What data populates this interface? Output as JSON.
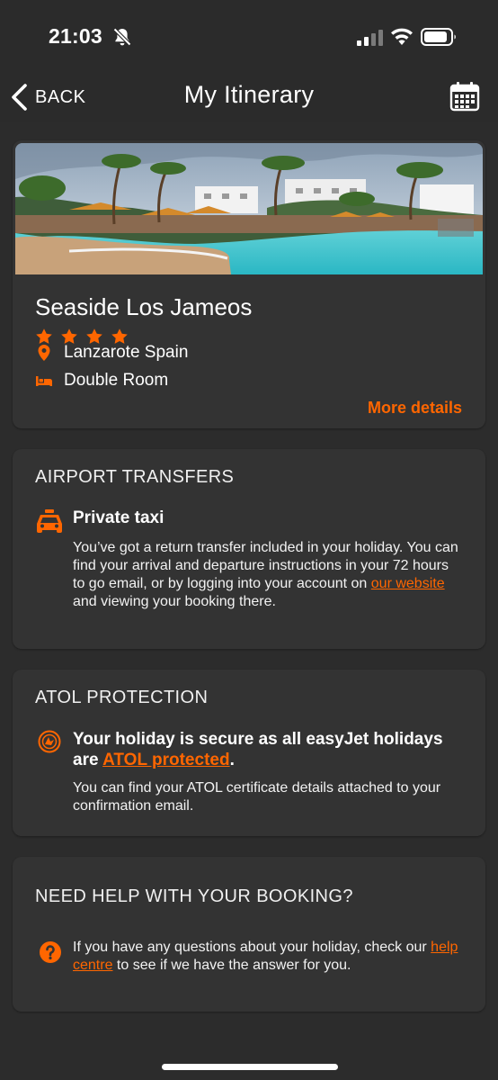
{
  "status_bar": {
    "time": "21:03"
  },
  "nav": {
    "back_label": "BACK",
    "title": "My Itinerary"
  },
  "hotel": {
    "name": "Seaside Los Jameos",
    "star_rating": 4,
    "location": "Lanzarote Spain",
    "room": "Double Room",
    "more_details": "More details"
  },
  "transfers": {
    "section_title": "AIRPORT TRANSFERS",
    "heading": "Private taxi",
    "body_before_link": "You’ve got a return transfer included in your holiday. You can find your arrival and departure instructions in your 72 hours to go email, or by logging into your account on ",
    "link": "our website",
    "body_after_link": " and viewing your booking there."
  },
  "atol": {
    "section_title": "ATOL PROTECTION",
    "heading_before_link": "Your holiday is secure as all easyJet holidays are ",
    "link": "ATOL protected",
    "heading_after_link": ".",
    "body": "You can find your ATOL certificate details attached to your confirmation email."
  },
  "help": {
    "section_title": "NEED HELP WITH YOUR BOOKING?",
    "body_before_link": "If you have any questions about your holiday, check our ",
    "link": "help centre",
    "body_after_link": " to see if we have the answer for you."
  },
  "colors": {
    "accent": "#ff6600",
    "background": "#2c2c2c",
    "card": "#333333",
    "text": "#ffffff"
  },
  "icons": {
    "bell": "bell-slash-icon",
    "signal": "cellular-signal-icon",
    "wifi": "wifi-icon",
    "battery": "battery-icon",
    "back": "chevron-left-icon",
    "calendar": "calendar-icon",
    "star": "star-icon",
    "location": "map-pin-icon",
    "room": "bed-icon",
    "taxi": "taxi-icon",
    "atol": "atol-shield-icon",
    "help": "question-circle-icon"
  }
}
